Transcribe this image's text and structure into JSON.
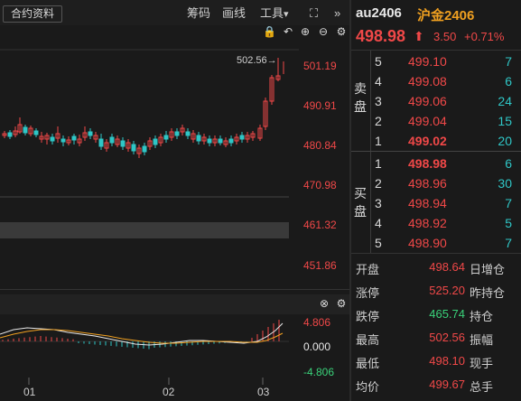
{
  "toolbar": {
    "info_btn": "合约资料",
    "chips": "筹码",
    "draw": "画线",
    "tools": "工具",
    "tools_arrow": "▾",
    "fullscreen": "⛶",
    "collapse": "»"
  },
  "chart_controls": {
    "lock": "🔒",
    "undo": "↶",
    "zoom_in": "⊕",
    "zoom_out": "⊖",
    "settings": "⚙"
  },
  "main_chart": {
    "peak_annotation": "502.56→",
    "y_ticks": [
      "501.19",
      "490.91",
      "480.84",
      "470.98",
      "461.32",
      "451.86"
    ]
  },
  "sub_chart": {
    "close": "⊗",
    "settings": "⚙",
    "y_ticks": [
      "4.806",
      "0.000",
      "-4.806"
    ],
    "x_ticks": [
      "01",
      "02",
      "03"
    ]
  },
  "quote": {
    "code": "au2406",
    "name": "沪金2406",
    "last": "498.98",
    "arrow": "⬆",
    "change": "3.50",
    "change_pct": "+0.71%"
  },
  "orderbook": {
    "sell_label": "卖盘",
    "buy_label": "买盘",
    "asks": [
      {
        "level": "5",
        "price": "499.10",
        "qty": "7"
      },
      {
        "level": "4",
        "price": "499.08",
        "qty": "6"
      },
      {
        "level": "3",
        "price": "499.06",
        "qty": "24"
      },
      {
        "level": "2",
        "price": "499.04",
        "qty": "15"
      },
      {
        "level": "1",
        "price": "499.02",
        "qty": "20"
      }
    ],
    "bids": [
      {
        "level": "1",
        "price": "498.98",
        "qty": "6"
      },
      {
        "level": "2",
        "price": "498.96",
        "qty": "30"
      },
      {
        "level": "3",
        "price": "498.94",
        "qty": "7"
      },
      {
        "level": "4",
        "price": "498.92",
        "qty": "5"
      },
      {
        "level": "5",
        "price": "498.90",
        "qty": "7"
      }
    ]
  },
  "stats": [
    {
      "label": "开盘",
      "value": "498.64",
      "color": "#f04848",
      "right": "日增仓"
    },
    {
      "label": "涨停",
      "value": "525.20",
      "color": "#f04848",
      "right": "昨持仓"
    },
    {
      "label": "跌停",
      "value": "465.74",
      "color": "#3ad27a",
      "right": "持仓"
    },
    {
      "label": "最高",
      "value": "502.56",
      "color": "#f04848",
      "right": "振幅"
    },
    {
      "label": "最低",
      "value": "498.10",
      "color": "#f04848",
      "right": "现手"
    },
    {
      "label": "均价",
      "value": "499.67",
      "color": "#f04848",
      "right": "总手"
    }
  ],
  "colors": {
    "up": "#f04848",
    "down": "#2fc6c6",
    "accent": "#f0a020",
    "limit_down": "#3ad27a"
  }
}
